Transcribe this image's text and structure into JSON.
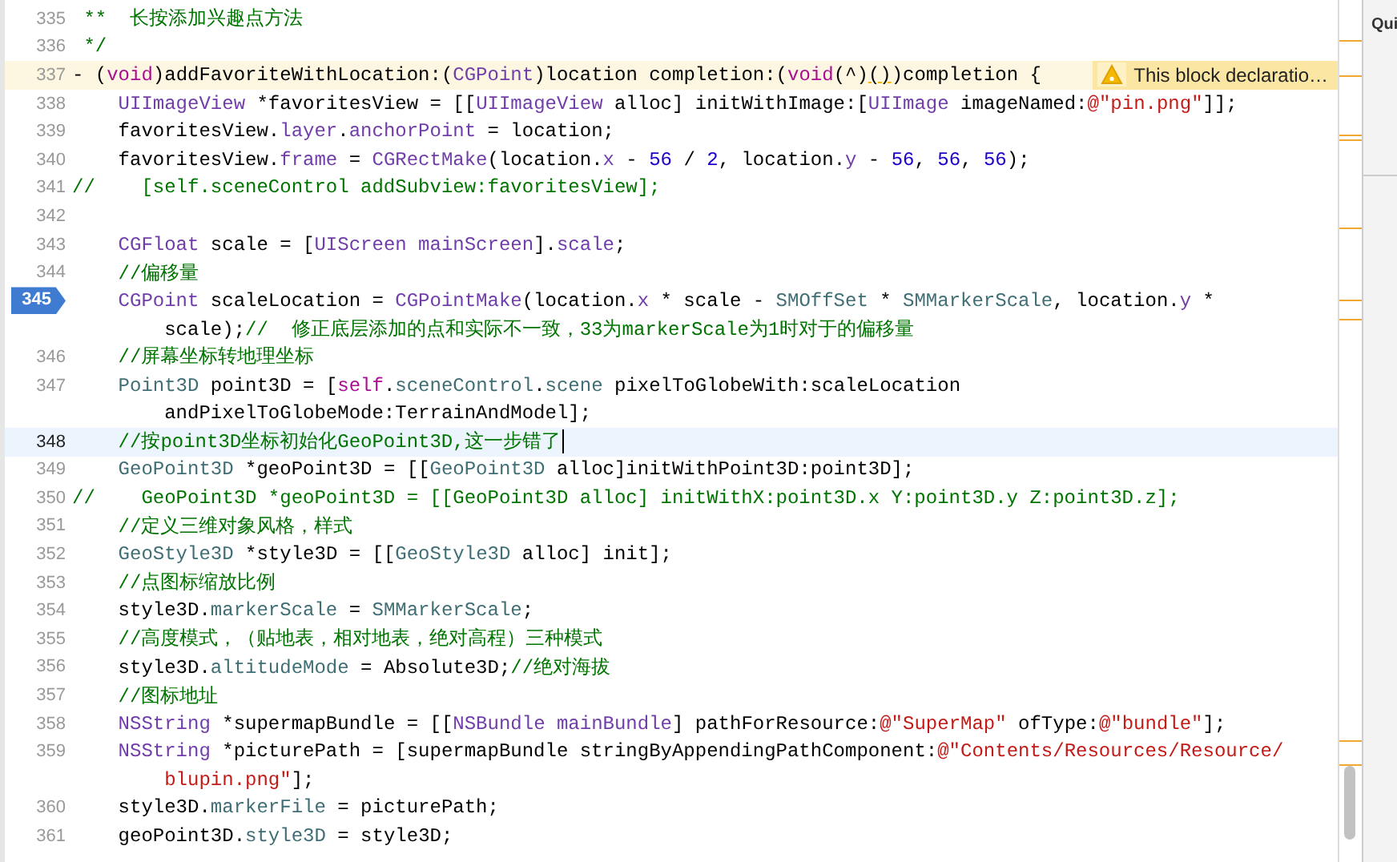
{
  "panel": {
    "title": "Qui"
  },
  "lines": [
    {
      "number": "335",
      "breakpoint": false,
      "current": false,
      "parts": [
        {
          "tokens": [
            {
              "kind": "comment",
              "text": " **  长按添加兴趣点方法"
            }
          ]
        }
      ]
    },
    {
      "number": "336",
      "breakpoint": false,
      "current": false,
      "parts": [
        {
          "tokens": [
            {
              "kind": "comment",
              "text": " */"
            }
          ]
        }
      ]
    },
    {
      "number": "337",
      "breakpoint": false,
      "current": false,
      "warning": {
        "message": "This block declaratio…"
      },
      "parts": [
        {
          "tokens": [
            {
              "kind": "plain",
              "text": "- ("
            },
            {
              "kind": "keyword",
              "text": "void"
            },
            {
              "kind": "plain",
              "text": ")addFavoriteWithLocation:("
            },
            {
              "kind": "type",
              "text": "CGPoint"
            },
            {
              "kind": "plain",
              "text": ")location completion:("
            },
            {
              "kind": "keyword",
              "text": "void"
            },
            {
              "kind": "plain",
              "text": "(^)"
            },
            {
              "kind": "flag",
              "text": "()"
            },
            {
              "kind": "plain",
              "text": ")completion {"
            }
          ]
        }
      ]
    },
    {
      "number": "338",
      "breakpoint": false,
      "current": false,
      "parts": [
        {
          "tokens": [
            {
              "kind": "type",
              "text": "    UIImageView"
            },
            {
              "kind": "plain",
              "text": " *favoritesView = [["
            },
            {
              "kind": "type",
              "text": "UIImageView"
            },
            {
              "kind": "plain",
              "text": " alloc] initWithImage:["
            },
            {
              "kind": "type",
              "text": "UIImage"
            },
            {
              "kind": "plain",
              "text": " imageNamed:"
            },
            {
              "kind": "string",
              "text": "@\"pin.png\""
            },
            {
              "kind": "plain",
              "text": "]];"
            }
          ]
        }
      ]
    },
    {
      "number": "339",
      "breakpoint": false,
      "current": false,
      "parts": [
        {
          "tokens": [
            {
              "kind": "plain",
              "text": "    favoritesView."
            },
            {
              "kind": "prop",
              "text": "layer"
            },
            {
              "kind": "plain",
              "text": "."
            },
            {
              "kind": "prop",
              "text": "anchorPoint"
            },
            {
              "kind": "plain",
              "text": " = location;"
            }
          ]
        }
      ]
    },
    {
      "number": "340",
      "breakpoint": false,
      "current": false,
      "parts": [
        {
          "tokens": [
            {
              "kind": "plain",
              "text": "    favoritesView."
            },
            {
              "kind": "prop",
              "text": "frame"
            },
            {
              "kind": "plain",
              "text": " = "
            },
            {
              "kind": "type",
              "text": "CGRectMake"
            },
            {
              "kind": "plain",
              "text": "(location."
            },
            {
              "kind": "prop",
              "text": "x"
            },
            {
              "kind": "plain",
              "text": " - "
            },
            {
              "kind": "number",
              "text": "56"
            },
            {
              "kind": "plain",
              "text": " / "
            },
            {
              "kind": "number",
              "text": "2"
            },
            {
              "kind": "plain",
              "text": ", location."
            },
            {
              "kind": "prop",
              "text": "y"
            },
            {
              "kind": "plain",
              "text": " - "
            },
            {
              "kind": "number",
              "text": "56"
            },
            {
              "kind": "plain",
              "text": ", "
            },
            {
              "kind": "number",
              "text": "56"
            },
            {
              "kind": "plain",
              "text": ", "
            },
            {
              "kind": "number",
              "text": "56"
            },
            {
              "kind": "plain",
              "text": ");"
            }
          ]
        }
      ]
    },
    {
      "number": "341",
      "breakpoint": false,
      "current": false,
      "parts": [
        {
          "tokens": [
            {
              "kind": "comment",
              "text": "//    [self.sceneControl addSubview:favoritesView];"
            }
          ]
        }
      ]
    },
    {
      "number": "342",
      "breakpoint": false,
      "current": false
    },
    {
      "number": "343",
      "breakpoint": false,
      "current": false,
      "parts": [
        {
          "tokens": [
            {
              "kind": "type",
              "text": "    CGFloat"
            },
            {
              "kind": "plain",
              "text": " scale = ["
            },
            {
              "kind": "type",
              "text": "UIScreen"
            },
            {
              "kind": "prop",
              "text": " mainScreen"
            },
            {
              "kind": "plain",
              "text": "]."
            },
            {
              "kind": "prop",
              "text": "scale"
            },
            {
              "kind": "plain",
              "text": ";"
            }
          ]
        }
      ]
    },
    {
      "number": "344",
      "breakpoint": false,
      "current": false,
      "parts": [
        {
          "tokens": [
            {
              "kind": "comment",
              "text": "    //偏移量"
            }
          ]
        }
      ]
    },
    {
      "number": "345",
      "breakpoint": true,
      "current": false,
      "parts": [
        {
          "tokens": [
            {
              "kind": "type",
              "text": "    CGPoint"
            },
            {
              "kind": "plain",
              "text": " scaleLocation = "
            },
            {
              "kind": "type",
              "text": "CGPointMake"
            },
            {
              "kind": "plain",
              "text": "(location."
            },
            {
              "kind": "prop",
              "text": "x"
            },
            {
              "kind": "plain",
              "text": " * scale - "
            },
            {
              "kind": "project",
              "text": "SMOffSet"
            },
            {
              "kind": "plain",
              "text": " * "
            },
            {
              "kind": "project",
              "text": "SMMarkerScale"
            },
            {
              "kind": "plain",
              "text": ", location."
            },
            {
              "kind": "prop",
              "text": "y"
            },
            {
              "kind": "plain",
              "text": " *"
            }
          ]
        },
        {
          "tokens": [
            {
              "kind": "plain",
              "text": "        scale);"
            },
            {
              "kind": "comment",
              "text": "//  修正底层添加的点和实际不一致，33为markerScale为1时对于的偏移量"
            }
          ]
        }
      ]
    },
    {
      "number": "346",
      "breakpoint": false,
      "current": false,
      "parts": [
        {
          "tokens": [
            {
              "kind": "comment",
              "text": "    //屏幕坐标转地理坐标"
            }
          ]
        }
      ]
    },
    {
      "number": "347",
      "breakpoint": false,
      "current": false,
      "parts": [
        {
          "tokens": [
            {
              "kind": "project",
              "text": "    Point3D"
            },
            {
              "kind": "plain",
              "text": " point3D = ["
            },
            {
              "kind": "keyword",
              "text": "self"
            },
            {
              "kind": "plain",
              "text": "."
            },
            {
              "kind": "project",
              "text": "sceneControl"
            },
            {
              "kind": "plain",
              "text": "."
            },
            {
              "kind": "project",
              "text": "scene"
            },
            {
              "kind": "plain",
              "text": " pixelToGlobeWith:scaleLocation"
            }
          ]
        },
        {
          "tokens": [
            {
              "kind": "plain",
              "text": "        andPixelToGlobeMode:TerrainAndModel];"
            }
          ]
        }
      ]
    },
    {
      "number": "348",
      "breakpoint": false,
      "current": true,
      "parts": [
        {
          "tokens": [
            {
              "kind": "comment",
              "text": "    //按point3D坐标初始化GeoPoint3D,这一步错了"
            }
          ]
        }
      ]
    },
    {
      "number": "349",
      "breakpoint": false,
      "current": false,
      "parts": [
        {
          "tokens": [
            {
              "kind": "project",
              "text": "    GeoPoint3D"
            },
            {
              "kind": "plain",
              "text": " *geoPoint3D = [["
            },
            {
              "kind": "project",
              "text": "GeoPoint3D"
            },
            {
              "kind": "plain",
              "text": " alloc]initWithPoint3D:point3D];"
            }
          ]
        }
      ]
    },
    {
      "number": "350",
      "breakpoint": false,
      "current": false,
      "parts": [
        {
          "tokens": [
            {
              "kind": "comment",
              "text": "//    GeoPoint3D *geoPoint3D = [[GeoPoint3D alloc] initWithX:point3D.x Y:point3D.y Z:point3D.z];"
            }
          ]
        }
      ]
    },
    {
      "number": "351",
      "breakpoint": false,
      "current": false,
      "parts": [
        {
          "tokens": [
            {
              "kind": "comment",
              "text": "    //定义三维对象风格，样式"
            }
          ]
        }
      ]
    },
    {
      "number": "352",
      "breakpoint": false,
      "current": false,
      "parts": [
        {
          "tokens": [
            {
              "kind": "project",
              "text": "    GeoStyle3D"
            },
            {
              "kind": "plain",
              "text": " *style3D = [["
            },
            {
              "kind": "project",
              "text": "GeoStyle3D"
            },
            {
              "kind": "plain",
              "text": " alloc] init];"
            }
          ]
        }
      ]
    },
    {
      "number": "353",
      "breakpoint": false,
      "current": false,
      "parts": [
        {
          "tokens": [
            {
              "kind": "comment",
              "text": "    //点图标缩放比例"
            }
          ]
        }
      ]
    },
    {
      "number": "354",
      "breakpoint": false,
      "current": false,
      "parts": [
        {
          "tokens": [
            {
              "kind": "plain",
              "text": "    style3D."
            },
            {
              "kind": "project",
              "text": "markerScale"
            },
            {
              "kind": "plain",
              "text": " = "
            },
            {
              "kind": "project",
              "text": "SMMarkerScale"
            },
            {
              "kind": "plain",
              "text": ";"
            }
          ]
        }
      ]
    },
    {
      "number": "355",
      "breakpoint": false,
      "current": false,
      "parts": [
        {
          "tokens": [
            {
              "kind": "comment",
              "text": "    //高度模式，（贴地表，相对地表，绝对高程）三种模式"
            }
          ]
        }
      ]
    },
    {
      "number": "356",
      "breakpoint": false,
      "current": false,
      "parts": [
        {
          "tokens": [
            {
              "kind": "plain",
              "text": "    style3D."
            },
            {
              "kind": "project",
              "text": "altitudeMode"
            },
            {
              "kind": "plain",
              "text": " = Absolute3D;"
            },
            {
              "kind": "comment",
              "text": "//绝对海拔"
            }
          ]
        }
      ]
    },
    {
      "number": "357",
      "breakpoint": false,
      "current": false,
      "parts": [
        {
          "tokens": [
            {
              "kind": "comment",
              "text": "    //图标地址"
            }
          ]
        }
      ]
    },
    {
      "number": "358",
      "breakpoint": false,
      "current": false,
      "parts": [
        {
          "tokens": [
            {
              "kind": "type",
              "text": "    NSString"
            },
            {
              "kind": "plain",
              "text": " *supermapBundle = [["
            },
            {
              "kind": "type",
              "text": "NSBundle"
            },
            {
              "kind": "prop",
              "text": " mainBundle"
            },
            {
              "kind": "plain",
              "text": "] pathForResource:"
            },
            {
              "kind": "string",
              "text": "@\"SuperMap\""
            },
            {
              "kind": "plain",
              "text": " ofType:"
            },
            {
              "kind": "string",
              "text": "@\"bundle\""
            },
            {
              "kind": "plain",
              "text": "];"
            }
          ]
        }
      ]
    },
    {
      "number": "359",
      "breakpoint": false,
      "current": false,
      "parts": [
        {
          "tokens": [
            {
              "kind": "type",
              "text": "    NSString"
            },
            {
              "kind": "plain",
              "text": " *picturePath = [supermapBundle stringByAppendingPathComponent:"
            },
            {
              "kind": "string",
              "text": "@\"Contents/Resources/Resource/"
            }
          ]
        },
        {
          "tokens": [
            {
              "kind": "string",
              "text": "        blupin.png\""
            },
            {
              "kind": "plain",
              "text": "];"
            }
          ]
        }
      ]
    },
    {
      "number": "360",
      "breakpoint": false,
      "current": false,
      "parts": [
        {
          "tokens": [
            {
              "kind": "plain",
              "text": "    style3D."
            },
            {
              "kind": "project",
              "text": "markerFile"
            },
            {
              "kind": "plain",
              "text": " = picturePath;"
            }
          ]
        }
      ]
    },
    {
      "number": "361",
      "breakpoint": false,
      "current": false,
      "parts": [
        {
          "tokens": [
            {
              "kind": "plain",
              "text": "    geoPoint3D."
            },
            {
              "kind": "project",
              "text": "style3D"
            },
            {
              "kind": "plain",
              "text": " = style3D;"
            }
          ]
        }
      ]
    }
  ]
}
